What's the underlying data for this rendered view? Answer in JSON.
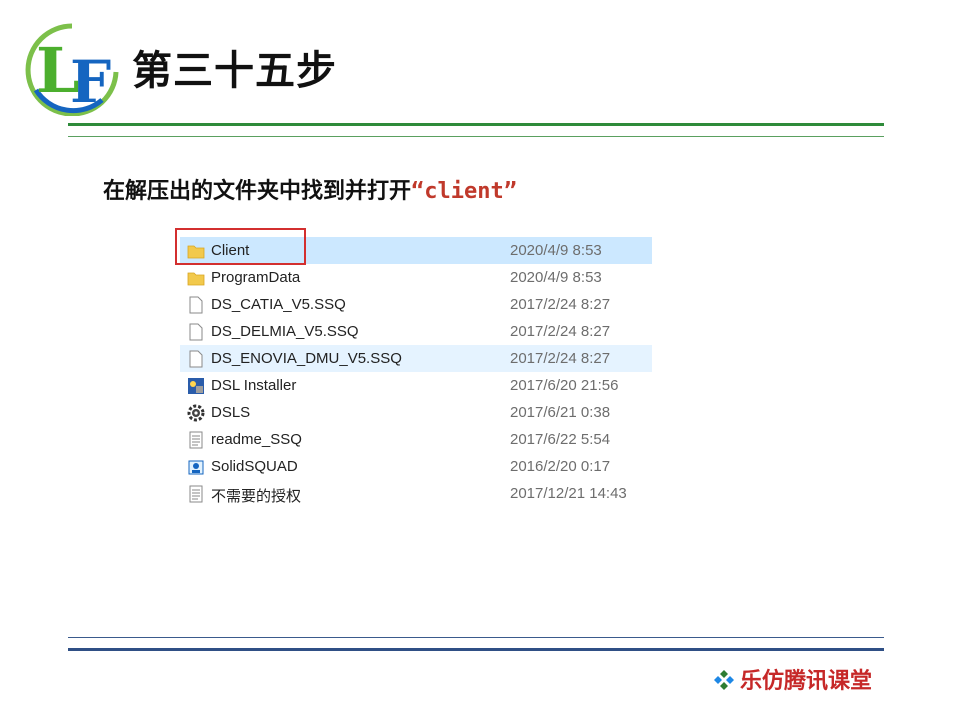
{
  "slide": {
    "title": "第三十五步",
    "instruction_prefix": "在解压出的文件夹中找到并打开",
    "instruction_highlight": "“client”"
  },
  "logo": {
    "icon": "lf-logo-icon",
    "colors": {
      "green": "#4caf2e",
      "blue": "#1565c0"
    }
  },
  "files": [
    {
      "name": "Client",
      "date": "2020/4/9 8:53",
      "icon": "folder-icon",
      "state": "selected"
    },
    {
      "name": "ProgramData",
      "date": "2020/4/9 8:53",
      "icon": "folder-icon",
      "state": ""
    },
    {
      "name": "DS_CATIA_V5.SSQ",
      "date": "2017/2/24 8:27",
      "icon": "file-icon",
      "state": ""
    },
    {
      "name": "DS_DELMIA_V5.SSQ",
      "date": "2017/2/24 8:27",
      "icon": "file-icon",
      "state": ""
    },
    {
      "name": "DS_ENOVIA_DMU_V5.SSQ",
      "date": "2017/2/24 8:27",
      "icon": "file-icon",
      "state": "hover"
    },
    {
      "name": "DSL Installer",
      "date": "2017/6/20 21:56",
      "icon": "installer-icon",
      "state": ""
    },
    {
      "name": "DSLS",
      "date": "2017/6/21 0:38",
      "icon": "gear-icon",
      "state": ""
    },
    {
      "name": "readme_SSQ",
      "date": "2017/6/22 5:54",
      "icon": "text-file-icon",
      "state": ""
    },
    {
      "name": "SolidSQUAD",
      "date": "2016/2/20 0:17",
      "icon": "app-icon",
      "state": ""
    },
    {
      "name": "不需要的授权",
      "date": "2017/12/21 14:43",
      "icon": "text-file-icon",
      "state": ""
    }
  ],
  "footer": {
    "brand": "乐仿腾讯课堂",
    "icon": "diamond-cluster-icon"
  },
  "colors": {
    "selection": "#cce8ff",
    "hover": "#e5f3ff",
    "highlight_box": "#d32f2f",
    "instruction_accent": "#c0392b",
    "brand_red": "#c62828"
  }
}
